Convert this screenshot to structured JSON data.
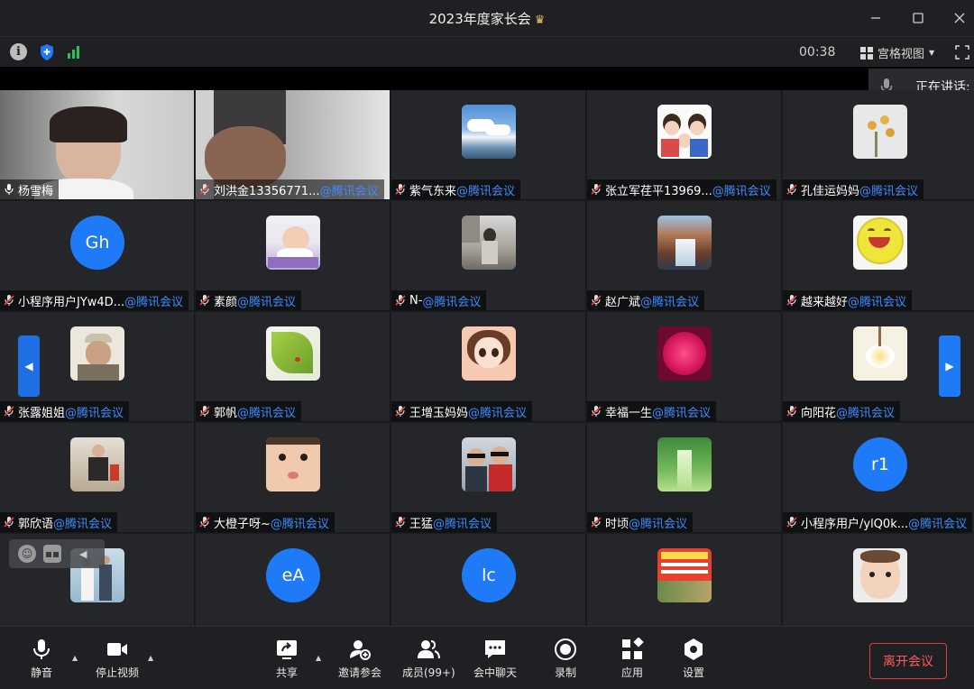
{
  "window": {
    "title": "2023年度家长会"
  },
  "infobar": {
    "timer": "00:38",
    "view_label": "宫格视图"
  },
  "speaking": {
    "label": "正在讲话:"
  },
  "colors": {
    "accent": "#1f7af7",
    "leave": "#e03a3a",
    "signal": "#2bc25a"
  },
  "tiles": [
    {
      "name": "杨雪梅",
      "app": "",
      "media": "camera-woman",
      "mic": "on"
    },
    {
      "name": "刘洪金13356771...",
      "app": "@腾讯会议",
      "media": "camera-man",
      "mic": "off"
    },
    {
      "name": "紫气东来",
      "app": "@腾讯会议",
      "media": "sky",
      "mic": "off"
    },
    {
      "name": "张立军荏平13969...",
      "app": "@腾讯会议",
      "media": "family-cartoon",
      "mic": "off"
    },
    {
      "name": "孔佳运妈妈",
      "app": "@腾讯会议",
      "media": "flowers-white",
      "mic": "off"
    },
    {
      "name": "小程序用户JYw4D...",
      "app": "@腾讯会议",
      "media": "letter",
      "letter": "Gh",
      "mic": "off"
    },
    {
      "name": "素颜",
      "app": "@腾讯会议",
      "media": "baby-lavender",
      "mic": "off"
    },
    {
      "name": "N-",
      "app": "@腾讯会议",
      "media": "girl-photo",
      "mic": "off"
    },
    {
      "name": "赵广斌",
      "app": "@腾讯会议",
      "media": "waterfall",
      "mic": "off"
    },
    {
      "name": "越来越好",
      "app": "@腾讯会议",
      "media": "smiley",
      "mic": "off"
    },
    {
      "name": "张露姐姐",
      "app": "@腾讯会议",
      "media": "man-cap",
      "mic": "off"
    },
    {
      "name": "郭帆",
      "app": "@腾讯会议",
      "media": "leaf",
      "mic": "off"
    },
    {
      "name": "王增玉妈妈",
      "app": "@腾讯会议",
      "media": "doll-girl",
      "mic": "off"
    },
    {
      "name": "幸福一生",
      "app": "@腾讯会议",
      "media": "peony",
      "mic": "off"
    },
    {
      "name": "向阳花",
      "app": "@腾讯会议",
      "media": "magnolia",
      "mic": "off"
    },
    {
      "name": "郭欣语",
      "app": "@腾讯会议",
      "media": "kid-indoor",
      "mic": "off"
    },
    {
      "name": "大橙子呀~",
      "app": "@腾讯会议",
      "media": "baby-face",
      "mic": "off"
    },
    {
      "name": "王猛",
      "app": "@腾讯会议",
      "media": "two-kids",
      "mic": "off"
    },
    {
      "name": "时顷",
      "app": "@腾讯会议",
      "media": "forest",
      "mic": "off"
    },
    {
      "name": "小程序用户/ylQ0k...",
      "app": "@腾讯会议",
      "media": "letter",
      "letter": "r1",
      "mic": "off"
    },
    {
      "name": "",
      "app": "",
      "media": "couple-photo",
      "mic": "off"
    },
    {
      "name": "",
      "app": "",
      "media": "letter",
      "letter": "eA",
      "mic": "off"
    },
    {
      "name": "",
      "app": "",
      "media": "letter",
      "letter": "lc",
      "mic": "off"
    },
    {
      "name": "",
      "app": "",
      "media": "ad-poster",
      "mic": "off"
    },
    {
      "name": "",
      "app": "",
      "media": "toddler",
      "mic": "off"
    }
  ],
  "toolbar": {
    "mute": "静音",
    "stop_video": "停止视频",
    "share": "共享",
    "invite": "邀请参会",
    "members": "成员(99+)",
    "chat": "会中聊天",
    "record": "录制",
    "apps": "应用",
    "settings": "设置",
    "leave": "离开会议"
  }
}
